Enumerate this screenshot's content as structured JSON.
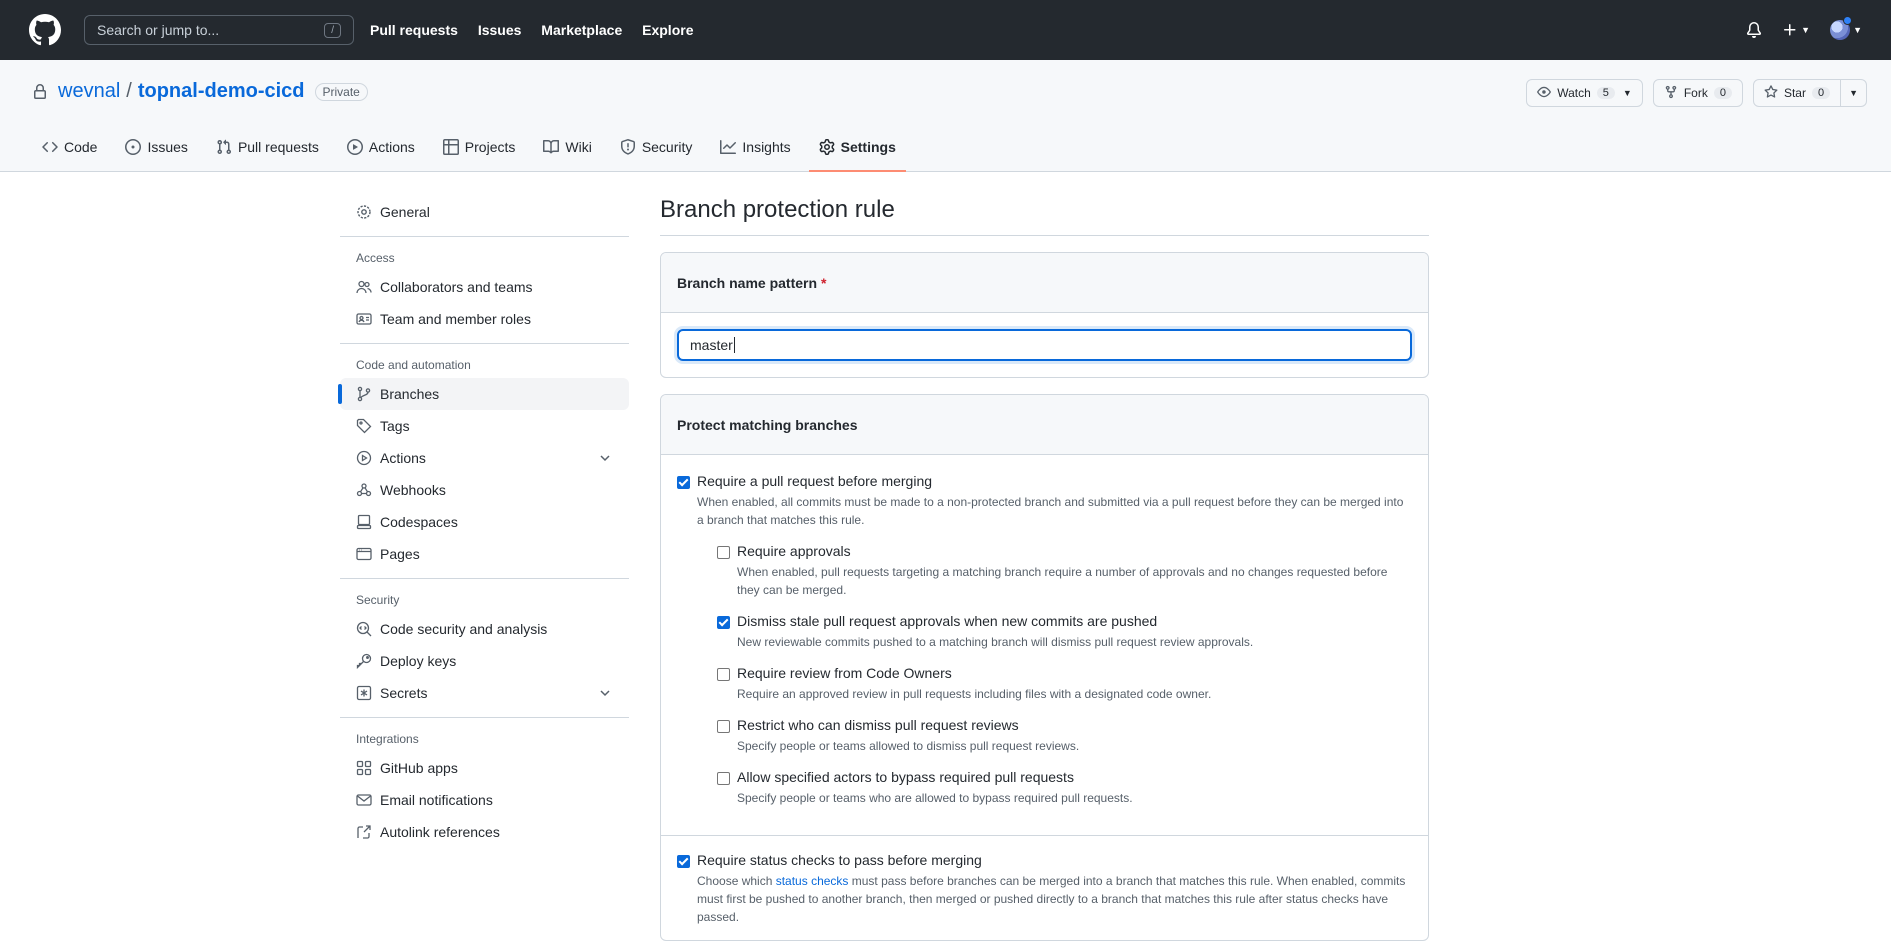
{
  "header": {
    "search_placeholder": "Search or jump to...",
    "search_shortcut": "/",
    "nav": [
      "Pull requests",
      "Issues",
      "Marketplace",
      "Explore"
    ]
  },
  "repo": {
    "owner": "wevnal",
    "separator": "/",
    "name": "topnal-demo-cicd",
    "visibility": "Private",
    "watch_label": "Watch",
    "watch_count": "5",
    "fork_label": "Fork",
    "fork_count": "0",
    "star_label": "Star",
    "star_count": "0"
  },
  "tabs": [
    {
      "label": "Code",
      "icon": "code-icon"
    },
    {
      "label": "Issues",
      "icon": "issue-icon"
    },
    {
      "label": "Pull requests",
      "icon": "pull-request-icon"
    },
    {
      "label": "Actions",
      "icon": "play-icon"
    },
    {
      "label": "Projects",
      "icon": "table-icon"
    },
    {
      "label": "Wiki",
      "icon": "book-icon"
    },
    {
      "label": "Security",
      "icon": "shield-icon"
    },
    {
      "label": "Insights",
      "icon": "graph-icon"
    },
    {
      "label": "Settings",
      "icon": "gear-icon",
      "active": true
    }
  ],
  "sidebar": {
    "general": "General",
    "access_heading": "Access",
    "access_items": [
      "Collaborators and teams",
      "Team and member roles"
    ],
    "code_heading": "Code and automation",
    "code_items": [
      "Branches",
      "Tags",
      "Actions",
      "Webhooks",
      "Codespaces",
      "Pages"
    ],
    "security_heading": "Security",
    "security_items": [
      "Code security and analysis",
      "Deploy keys",
      "Secrets"
    ],
    "integrations_heading": "Integrations",
    "integrations_items": [
      "GitHub apps",
      "Email notifications",
      "Autolink references"
    ]
  },
  "main": {
    "title": "Branch protection rule",
    "pattern_label": "Branch name pattern",
    "pattern_required": "*",
    "pattern_value": "master",
    "protect_heading": "Protect matching branches",
    "options": {
      "require_pr": {
        "label": "Require a pull request before merging",
        "desc": "When enabled, all commits must be made to a non-protected branch and submitted via a pull request before they can be merged into a branch that matches this rule.",
        "checked": true
      },
      "require_approvals": {
        "label": "Require approvals",
        "desc": "When enabled, pull requests targeting a matching branch require a number of approvals and no changes requested before they can be merged.",
        "checked": false
      },
      "dismiss_stale": {
        "label": "Dismiss stale pull request approvals when new commits are pushed",
        "desc": "New reviewable commits pushed to a matching branch will dismiss pull request review approvals.",
        "checked": true
      },
      "code_owners": {
        "label": "Require review from Code Owners",
        "desc": "Require an approved review in pull requests including files with a designated code owner.",
        "checked": false
      },
      "restrict_dismiss": {
        "label": "Restrict who can dismiss pull request reviews",
        "desc": "Specify people or teams allowed to dismiss pull request reviews.",
        "checked": false
      },
      "bypass": {
        "label": "Allow specified actors to bypass required pull requests",
        "desc": "Specify people or teams who are allowed to bypass required pull requests.",
        "checked": false
      },
      "status_checks": {
        "label": "Require status checks to pass before merging",
        "desc_pre": "Choose which ",
        "desc_link": "status checks",
        "desc_post": " must pass before branches can be merged into a branch that matches this rule. When enabled, commits must first be pushed to another branch, then merged or pushed directly to a branch that matches this rule after status checks have passed.",
        "checked": true
      }
    }
  },
  "colors": {
    "header_bg": "#24292f",
    "accent_blue": "#0969da",
    "active_tab_underline": "#fd8c73"
  }
}
